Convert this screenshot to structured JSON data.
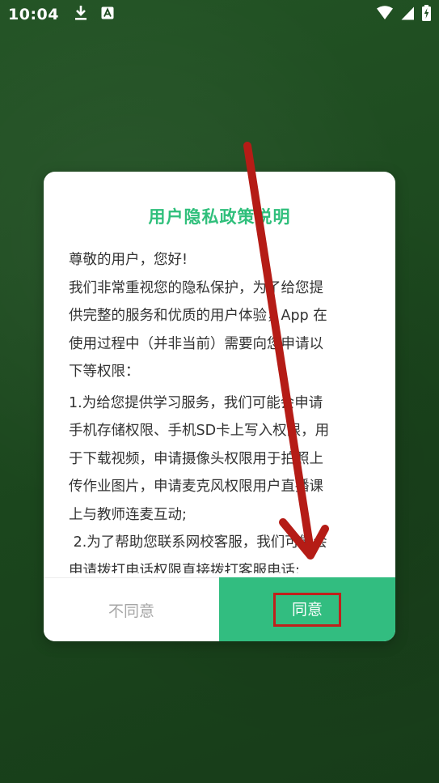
{
  "statusbar": {
    "time": "10:04",
    "icons": [
      "download-icon",
      "a-notification-icon",
      "wifi-icon",
      "cellular-icon",
      "battery-charging-icon"
    ]
  },
  "dialog": {
    "title": "用户隐私政策说明",
    "lines": [
      "尊敬的用户，您好!",
      "我们非常重视您的隐私保护，为了给您提",
      "供完整的服务和优质的用户体验，App 在",
      "使用过程中（并非当前）需要向您申请以",
      "下等权限：",
      "1.为给您提供学习服务，我们可能会申请",
      "手机存储权限、手机SD卡上写入权限，用",
      "于下载视频，申请摄像头权限用于拍照上",
      "传作业图片，申请麦克风权限用户直播课",
      "上与教师连麦互动;",
      " 2.为了帮助您联系网校客服，我们可能会",
      "申请拨打电话权限直接拨打客服电话;"
    ],
    "disagree_label": "不同意",
    "agree_label": "同意"
  },
  "colors": {
    "accent": "#32bd80",
    "title": "#2fbf7b",
    "annotation": "#c0201b",
    "background": "#1d4a1f"
  }
}
